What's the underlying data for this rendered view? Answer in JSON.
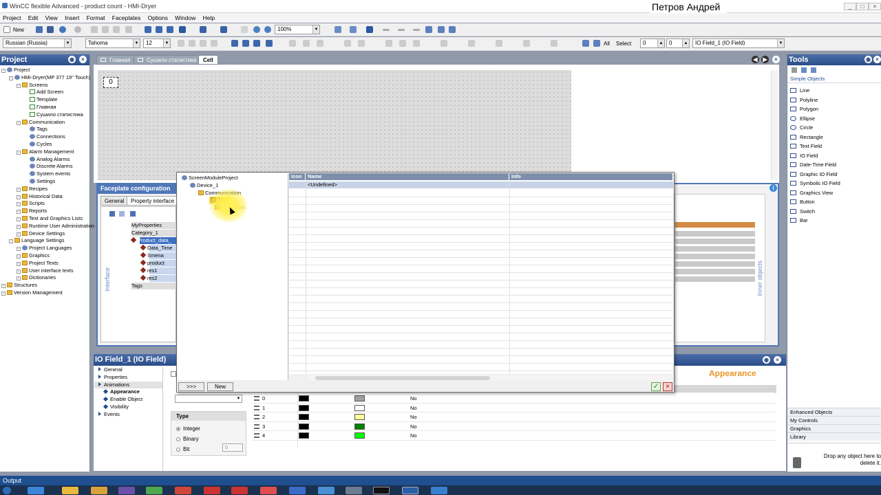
{
  "window": {
    "title": "WinCC flexible Advanced - product count - HMI-Dryer",
    "user": "Петров Андрей"
  },
  "menu": [
    "Project",
    "Edit",
    "View",
    "Insert",
    "Format",
    "Faceplates",
    "Options",
    "Window",
    "Help"
  ],
  "toolbar": {
    "new_label": "New",
    "zoom": "100%",
    "language": "Russian (Russia)",
    "font": "Tahoma",
    "font_size": "12",
    "all_label": "All",
    "select_label": "Select",
    "sel_a": "0",
    "sel_b": "0",
    "object_combo": "IO Field_1 (IO Field)"
  },
  "project": {
    "header": "Project",
    "items": [
      {
        "label": "Project",
        "indent": 0
      },
      {
        "label": "HMI-Dryer(MP 377 19\" Touch)",
        "indent": 1
      },
      {
        "label": "Screens",
        "indent": 2
      },
      {
        "label": "Add Screen",
        "indent": 3
      },
      {
        "label": "Template",
        "indent": 3
      },
      {
        "label": "Главная",
        "indent": 3
      },
      {
        "label": "Сушило статистика",
        "indent": 3
      },
      {
        "label": "Communication",
        "indent": 2
      },
      {
        "label": "Tags",
        "indent": 3
      },
      {
        "label": "Connections",
        "indent": 3
      },
      {
        "label": "Cycles",
        "indent": 3
      },
      {
        "label": "Alarm Management",
        "indent": 2
      },
      {
        "label": "Analog Alarms",
        "indent": 3
      },
      {
        "label": "Discrete Alarms",
        "indent": 3
      },
      {
        "label": "System events",
        "indent": 3
      },
      {
        "label": "Settings",
        "indent": 3
      },
      {
        "label": "Recipes",
        "indent": 2
      },
      {
        "label": "Historical Data",
        "indent": 2
      },
      {
        "label": "Scripts",
        "indent": 2
      },
      {
        "label": "Reports",
        "indent": 2
      },
      {
        "label": "Text and Graphics Lists",
        "indent": 2
      },
      {
        "label": "Runtime User Administration",
        "indent": 2
      },
      {
        "label": "Device Settings",
        "indent": 2
      },
      {
        "label": "Language Settings",
        "indent": 1
      },
      {
        "label": "Project Languages",
        "indent": 2
      },
      {
        "label": "Graphics",
        "indent": 2
      },
      {
        "label": "Project Texts",
        "indent": 2
      },
      {
        "label": "User interface texts",
        "indent": 2
      },
      {
        "label": "Dictionaries",
        "indent": 2
      },
      {
        "label": "Structures",
        "indent": 0
      },
      {
        "label": "Version Management",
        "indent": 0
      }
    ]
  },
  "tabs": [
    {
      "label": "Главная"
    },
    {
      "label": "Сушило статистика"
    },
    {
      "label": "Cell"
    }
  ],
  "canvas": {
    "field_value": "0"
  },
  "faceplate": {
    "header": "Faceplate configuration",
    "tab_general": "General",
    "tab_interface": "Property interface",
    "interface_label": "Interface",
    "inner_label": "Inner objects",
    "items": [
      {
        "label": "MyProperties"
      },
      {
        "label": "Category_1"
      },
      {
        "label": "Product_data_"
      },
      {
        "label": "Data_Time"
      },
      {
        "label": "Smena"
      },
      {
        "label": "product"
      },
      {
        "label": "res1"
      },
      {
        "label": "res2"
      },
      {
        "label": "Tags"
      }
    ]
  },
  "dialog": {
    "tree": [
      {
        "label": "ScreenModuleProject"
      },
      {
        "label": "Device_1"
      },
      {
        "label": "Communication"
      },
      {
        "label": "Tags"
      },
      {
        "label": "Properties"
      }
    ],
    "col_icon": "Icon",
    "col_name": "Name",
    "col_info": "Info",
    "row_undefined": "<Undefined>",
    "btn_more": ">>>",
    "btn_new": "New"
  },
  "props": {
    "header": "IO Field_1 (IO Field)",
    "nav": [
      {
        "label": "General"
      },
      {
        "label": "Properties"
      },
      {
        "label": "Animations"
      },
      {
        "label": "Appearance"
      },
      {
        "label": "Enable Object"
      },
      {
        "label": "Visibility"
      },
      {
        "label": "Events"
      }
    ],
    "section_title": "Appearance",
    "type_title": "Type",
    "type_integer": "Integer",
    "type_binary": "Binary",
    "type_bit": "Bit",
    "bit_value": "0",
    "rows": [
      {
        "value": "0",
        "fg": "#000000",
        "bg": "#a0a0a0",
        "flash": "No"
      },
      {
        "value": "1",
        "fg": "#000000",
        "bg": "#ffffff",
        "flash": "No"
      },
      {
        "value": "2",
        "fg": "#000000",
        "bg": "#ffff99",
        "flash": "No"
      },
      {
        "value": "3",
        "fg": "#000000",
        "bg": "#008000",
        "flash": "No"
      },
      {
        "value": "4",
        "fg": "#000000",
        "bg": "#00ff00",
        "flash": "No"
      }
    ]
  },
  "tools": {
    "header": "Tools",
    "section": "Simple Objects",
    "items": [
      {
        "label": "Line"
      },
      {
        "label": "Polyline"
      },
      {
        "label": "Polygon"
      },
      {
        "label": "Ellipse"
      },
      {
        "label": "Circle"
      },
      {
        "label": "Rectangle"
      },
      {
        "label": "Text Field"
      },
      {
        "label": "IO Field"
      },
      {
        "label": "Date-Time Field"
      },
      {
        "label": "Graphic IO Field"
      },
      {
        "label": "Symbolic IO Field"
      },
      {
        "label": "Graphics View"
      },
      {
        "label": "Button"
      },
      {
        "label": "Switch"
      },
      {
        "label": "Bar"
      }
    ],
    "sections": [
      {
        "label": "Enhanced Objects"
      },
      {
        "label": "My Controls"
      },
      {
        "label": "Graphics"
      },
      {
        "label": "Library"
      }
    ],
    "drop_hint": "Drop any object here to delete it."
  },
  "output": {
    "label": "Output"
  },
  "colors": {
    "panel_header": "#2a4d88",
    "accent": "#e8962a",
    "highlight": "#fff050"
  }
}
